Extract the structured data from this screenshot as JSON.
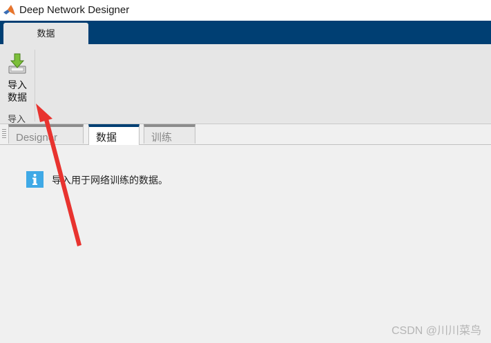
{
  "window": {
    "title": "Deep Network Designer"
  },
  "ribbon": {
    "tabs": [
      {
        "label": "数据"
      }
    ]
  },
  "toolstrip": {
    "import_button": {
      "line1": "导入",
      "line2": "数据"
    },
    "group_label": "导入"
  },
  "doc_tabs": [
    {
      "label": "Designer",
      "active": false
    },
    {
      "label": "数据",
      "active": true
    },
    {
      "label": "训练",
      "active": false
    }
  ],
  "content": {
    "info_text": "导入用于网络训练的数据。"
  },
  "watermark": "CSDN @川川菜鸟",
  "colors": {
    "ribbon_blue": "#003f73",
    "info_icon": "#3fa9e6",
    "arrow": "#e8332f"
  }
}
